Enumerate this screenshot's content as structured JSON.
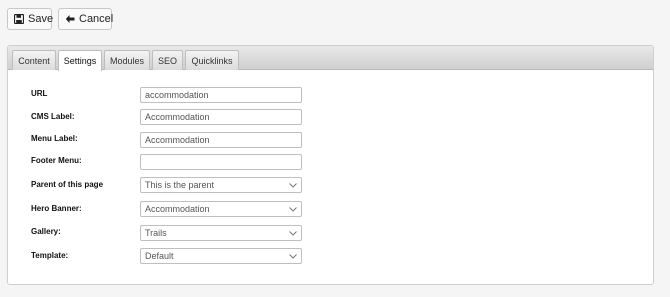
{
  "toolbar": {
    "save_label": "Save",
    "cancel_label": "Cancel"
  },
  "tabs": [
    {
      "label": "Content",
      "active": false
    },
    {
      "label": "Settings",
      "active": true
    },
    {
      "label": "Modules",
      "active": false
    },
    {
      "label": "SEO",
      "active": false
    },
    {
      "label": "Quicklinks",
      "active": false
    }
  ],
  "form": {
    "url": {
      "label": "URL",
      "value": "accommodation"
    },
    "cms_label": {
      "label": "CMS Label:",
      "value": "Accommodation"
    },
    "menu_label": {
      "label": "Menu Label:",
      "value": "Accommodation"
    },
    "footer_menu": {
      "label": "Footer Menu:",
      "value": ""
    },
    "parent": {
      "label": "Parent of this page",
      "value": "This is the parent"
    },
    "hero_banner": {
      "label": "Hero Banner:",
      "value": "Accommodation"
    },
    "gallery": {
      "label": "Gallery:",
      "value": "Trails"
    },
    "template": {
      "label": "Template:",
      "value": "Default"
    }
  },
  "icons": {
    "save": "floppy-disk-icon",
    "cancel": "arrow-left-icon",
    "dropdown": "chevron-down-icon"
  }
}
